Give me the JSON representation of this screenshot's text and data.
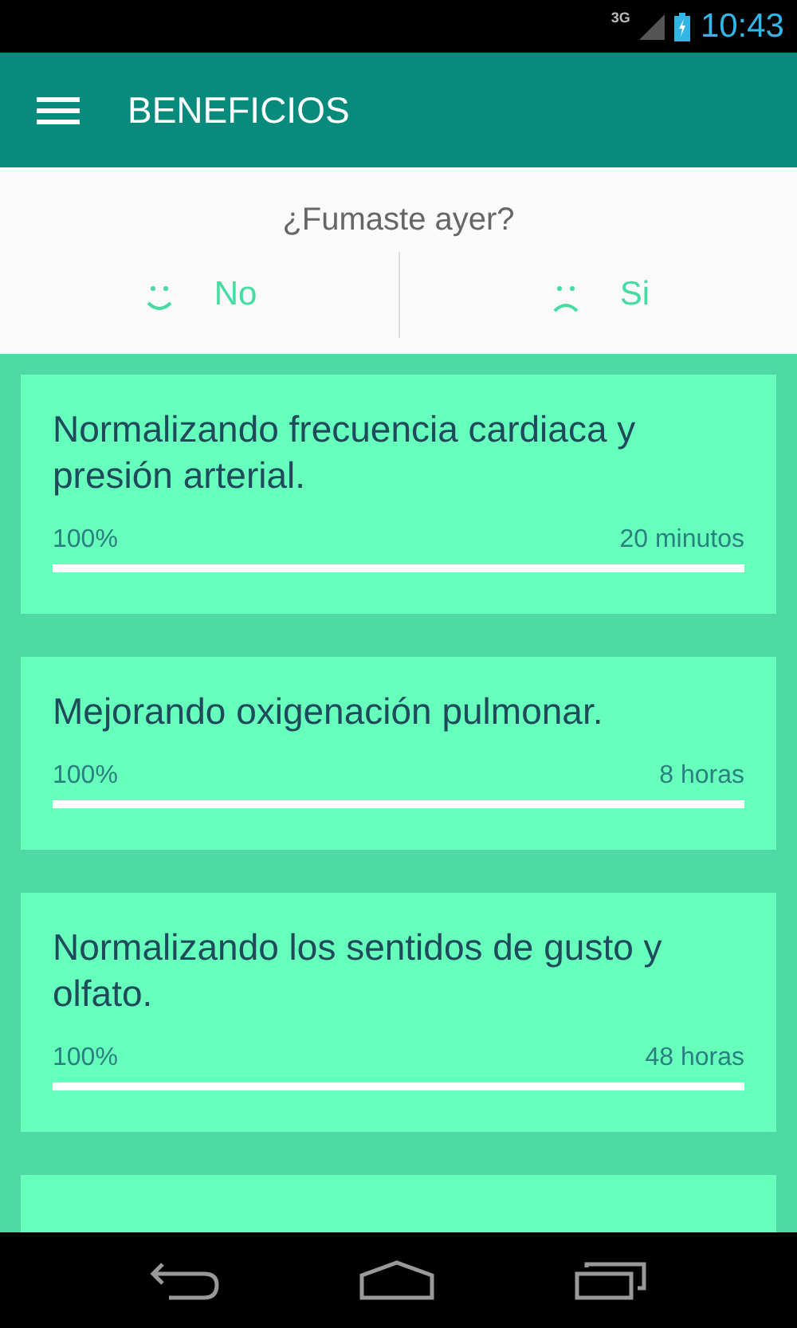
{
  "status_bar": {
    "network": "3G",
    "time": "10:43"
  },
  "app_bar": {
    "title": "BENEFICIOS"
  },
  "question": {
    "text": "¿Fumaste ayer?",
    "options": [
      {
        "kind": "happy",
        "label": "No"
      },
      {
        "kind": "sad",
        "label": "Si"
      }
    ]
  },
  "benefits": [
    {
      "title": "Normalizando frecuencia cardiaca y presión arterial.",
      "percent": "100%",
      "time": "20 minutos",
      "level": 1
    },
    {
      "title": "Mejorando oxigenación pulmonar.",
      "percent": "100%",
      "time": "8 horas",
      "level": 1
    },
    {
      "title": "Normalizando los sentidos de gusto y olfato.",
      "percent": "100%",
      "time": "48 horas",
      "level": 1
    }
  ]
}
